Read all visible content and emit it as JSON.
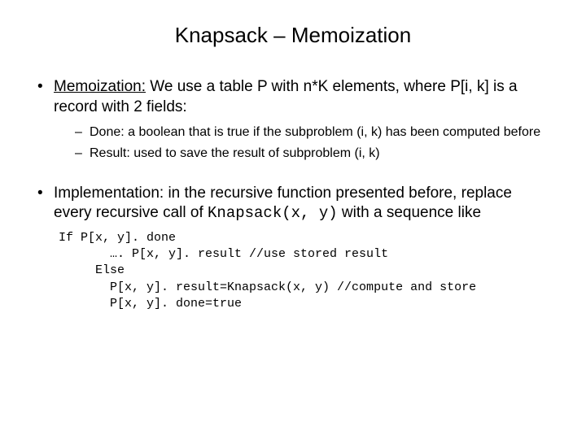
{
  "title": "Knapsack – Memoization",
  "bullet1": {
    "term": "Memoization:",
    "rest": " We use a table P with n*K elements, where P[i, k]  is a record with 2 fields:",
    "sub1": "Done: a boolean that is true if the subproblem (i, k) has been computed before",
    "sub2": "Result: used to save the result of subproblem (i, k)"
  },
  "bullet2": {
    "pre": "Implementation: in the recursive function presented before, replace every recursive call of ",
    "code": "Knapsack(x, y)",
    "post": " with a sequence like",
    "codeblock": "If P[x, y]. done\n       …. P[x, y]. result //use stored result\n     Else\n       P[x, y]. result=Knapsack(x, y) //compute and store\n       P[x, y]. done=true"
  }
}
